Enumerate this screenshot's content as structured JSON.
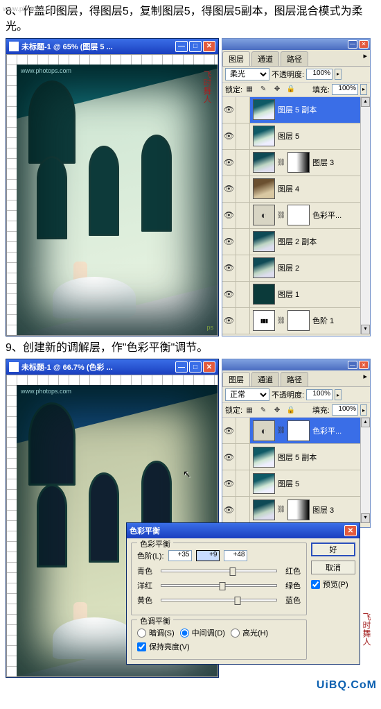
{
  "watermark_top": "www.photops.com",
  "watermark_bottom": "UiBQ.CoM",
  "step1_text": "8、作盖印图层，得图层5，复制图层5，得图层5副本，图层混合模式为柔光。",
  "step2_text": "9、创建新的调解层，作\"色彩平衡\"调节。",
  "win1": {
    "title": "未标题-1 @ 65% (图层 5 ...",
    "canvas_url": "www.photops.com",
    "sig": "ps",
    "seal": "飞时舞人"
  },
  "win2": {
    "title": "未标题-1 @ 66.7% (色彩 ...",
    "canvas_url": "www.photops.com",
    "seal": "飞时舞人"
  },
  "palette": {
    "tabs": [
      "图层",
      "通道",
      "路径"
    ],
    "blend_mode1": "柔光",
    "blend_mode2": "正常",
    "opacity_label": "不透明度:",
    "opacity_value": "100%",
    "lock_label": "锁定:",
    "fill_label": "填充:",
    "fill_value": "100%",
    "layers1": [
      {
        "name": "图层 5 副本",
        "thumb": "photo1",
        "selected": true
      },
      {
        "name": "图层 5",
        "thumb": "photo1"
      },
      {
        "name": "图层 3",
        "thumb": "photo2",
        "mask": "mask-grad"
      },
      {
        "name": "图层 4",
        "thumb": "sepia"
      },
      {
        "name": "色彩平...",
        "thumb": "adj",
        "mask": "mask"
      },
      {
        "name": "图层 2 副本",
        "thumb": "photo2"
      },
      {
        "name": "图层 2",
        "thumb": "photo2"
      },
      {
        "name": "图层 1",
        "thumb": "dark"
      },
      {
        "name": "色阶 1",
        "thumb": "levels",
        "mask": "mask"
      }
    ],
    "layers2": [
      {
        "name": "色彩平...",
        "thumb": "adj",
        "mask": "mask",
        "selected": true
      },
      {
        "name": "图层 5 副本",
        "thumb": "photo1"
      },
      {
        "name": "图层 5",
        "thumb": "photo1"
      },
      {
        "name": "图层 3",
        "thumb": "photo2",
        "mask": "mask-grad"
      }
    ]
  },
  "dialog": {
    "title": "色彩平衡",
    "group1_title": "色彩平衡",
    "level_label": "色阶(L):",
    "values": [
      "+35",
      "+9",
      "+48"
    ],
    "sliders": [
      {
        "left": "青色",
        "right": "红色",
        "pos": 62
      },
      {
        "left": "洋红",
        "right": "绿色",
        "pos": 53
      },
      {
        "left": "黄色",
        "right": "蓝色",
        "pos": 66
      }
    ],
    "group2_title": "色调平衡",
    "radios": [
      "暗调(S)",
      "中间调(D)",
      "高光(H)"
    ],
    "radio_selected": 1,
    "preserve_label": "保持亮度(V)",
    "ok": "好",
    "cancel": "取消",
    "preview": "预览(P)"
  }
}
